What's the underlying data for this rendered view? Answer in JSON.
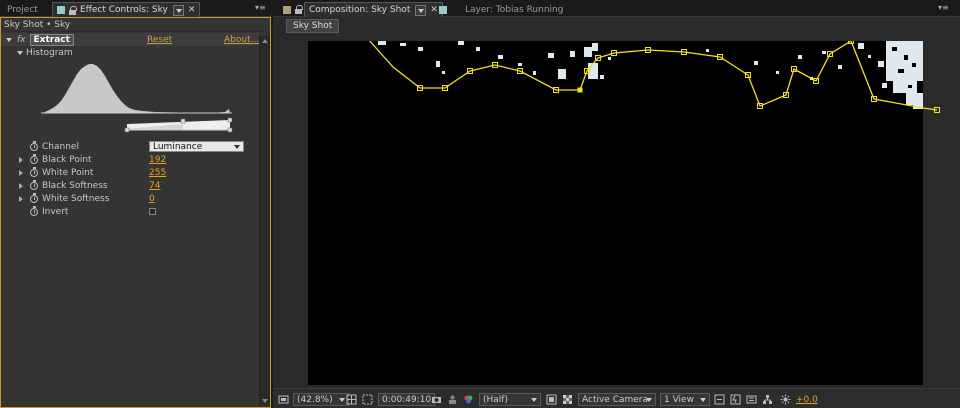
{
  "left_tabs": {
    "project": "Project",
    "effect_controls": "Effect Controls: Sky"
  },
  "right_tabs": {
    "composition": "Composition: Sky Shot",
    "layer": "Layer: Tobias Running"
  },
  "effect_controls": {
    "breadcrumb": "Sky Shot • Sky",
    "fx_label": "fx",
    "effect_name": "Extract",
    "reset": "Reset",
    "about": "About...",
    "histogram_label": "Histogram",
    "properties": [
      {
        "label": "Channel",
        "value": "Luminance"
      },
      {
        "label": "Black Point",
        "value": "192"
      },
      {
        "label": "White Point",
        "value": "255"
      },
      {
        "label": "Black Softness",
        "value": "74"
      },
      {
        "label": "White Softness",
        "value": "0"
      },
      {
        "label": "Invert",
        "value": ""
      }
    ]
  },
  "composition": {
    "breadcrumb_tab": "Sky Shot",
    "zoom": "(42.8%)",
    "timecode": "0:00:49:10",
    "resolution": "(Half)",
    "camera": "Active Camera",
    "view": "1 View",
    "exposure": "+0.0"
  },
  "colors": {
    "accent_orange": "#e5a229",
    "panel_border": "#c89a2a",
    "mask_yellow": "#f2e11a",
    "effect_swatch": "#8fd0cc",
    "comp_swatch": "#b49a7e"
  }
}
